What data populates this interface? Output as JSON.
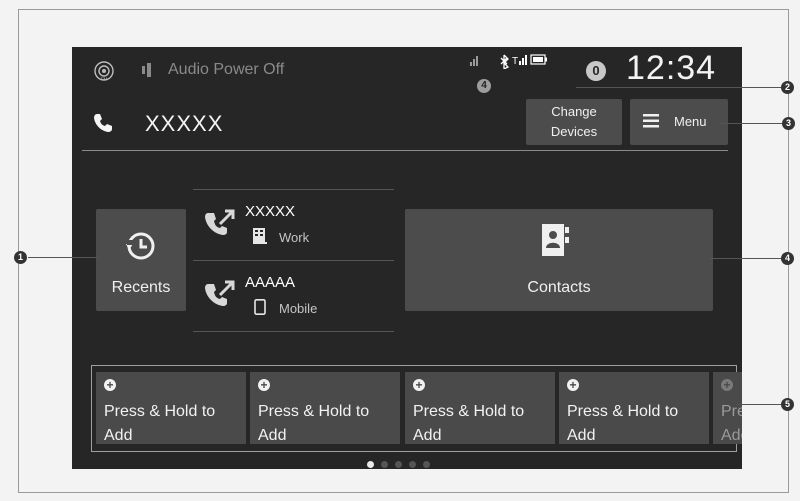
{
  "status_bar": {
    "fm_icon": "fm-radio-icon",
    "audio_icon": "audio-speaker-icon",
    "audio_status": "Audio Power Off",
    "status_icons": [
      "phone-signal-icon",
      "bluetooth-icon",
      "signal-bars-icon",
      "battery-icon"
    ],
    "notification_count": "4",
    "badge_count": "0",
    "time": "12:34"
  },
  "header": {
    "phone_icon": "phone-handset-icon",
    "device_name": "XXXXX",
    "change_devices_line1": "Change",
    "change_devices_line2": "Devices",
    "menu_label": "Menu"
  },
  "recents": {
    "label": "Recents",
    "icon": "clock-history-icon",
    "items": [
      {
        "name": "XXXXX",
        "type": "Work",
        "type_icon": "building-icon"
      },
      {
        "name": "AAAAA",
        "type": "Mobile",
        "type_icon": "mobile-phone-icon"
      }
    ]
  },
  "contacts": {
    "label": "Contacts",
    "icon": "contacts-book-icon"
  },
  "shortcuts": [
    {
      "line1": "Press & Hold to",
      "line2": "Add"
    },
    {
      "line1": "Press & Hold to",
      "line2": "Add"
    },
    {
      "line1": "Press & Hold to",
      "line2": "Add"
    },
    {
      "line1": "Press & Hold to",
      "line2": "Add"
    },
    {
      "line1": "Press & Hold to",
      "line2": "Add"
    }
  ],
  "pagination": {
    "pages": 5,
    "active": 0
  },
  "callouts": [
    "1",
    "2",
    "3",
    "4",
    "5"
  ]
}
